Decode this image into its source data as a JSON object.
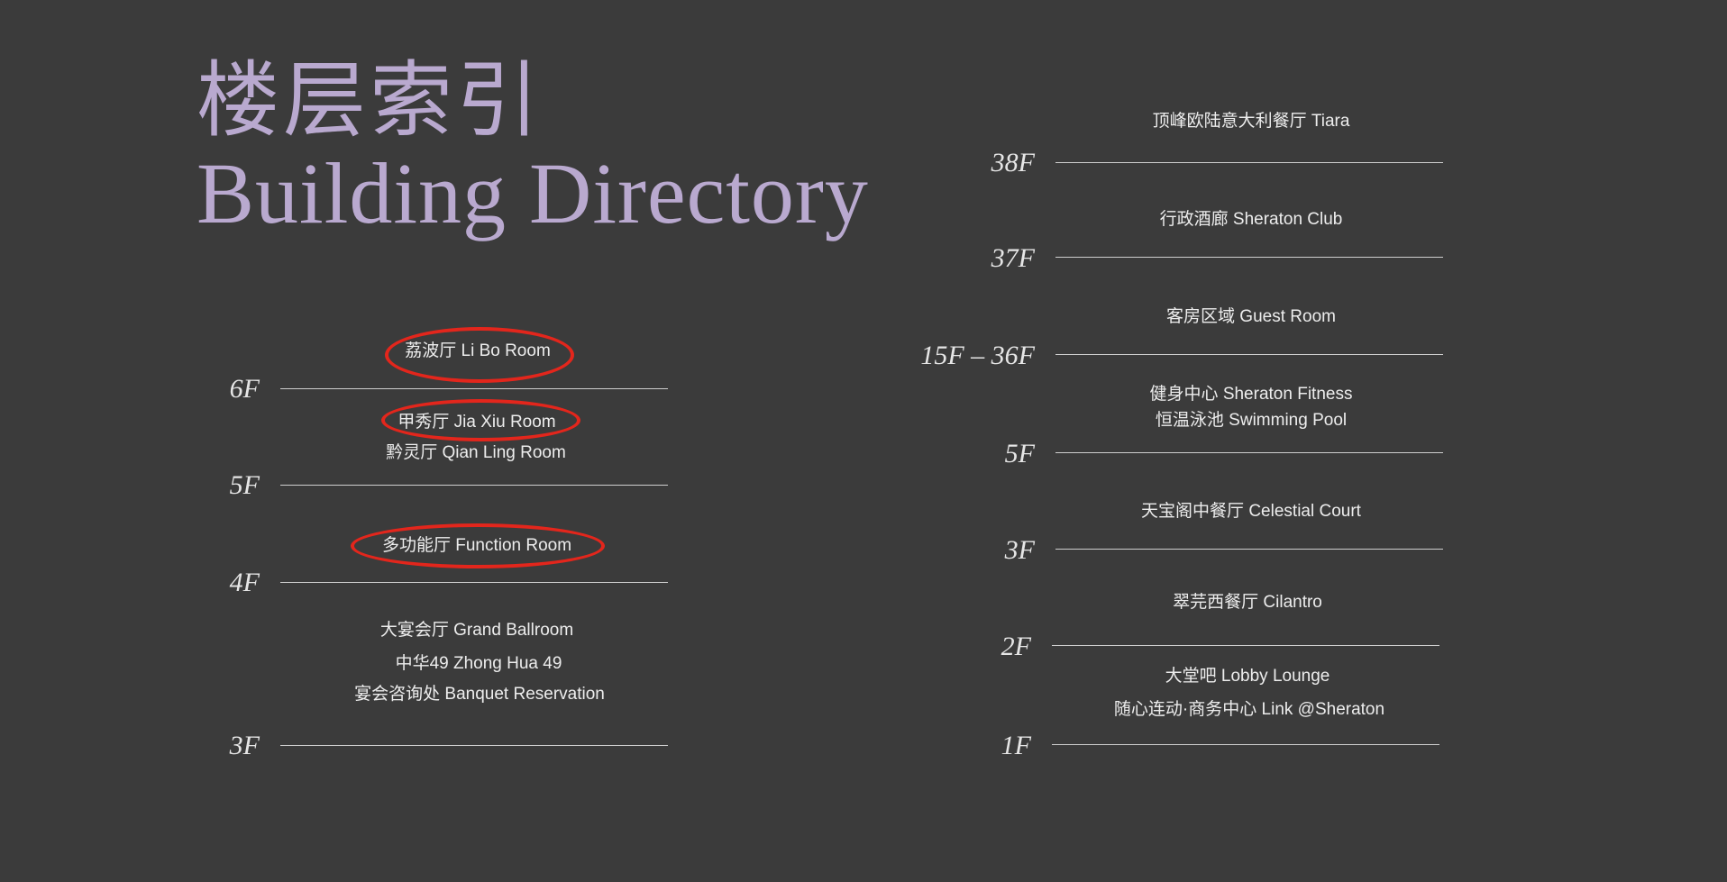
{
  "title": {
    "cn": "楼层索引",
    "en": "Building Directory"
  },
  "left_floors": {
    "f6": "6F",
    "f5": "5F",
    "f4": "4F",
    "f3": "3F"
  },
  "left_rooms": {
    "li_bo": "荔波厅 Li Bo Room",
    "jia_xiu": "甲秀厅 Jia Xiu Room",
    "qian_ling": "黔灵厅 Qian Ling Room",
    "function_room": "多功能厅 Function Room",
    "grand_ballroom": "大宴会厅 Grand Ballroom",
    "zhong_hua": "中华49 Zhong Hua 49",
    "banquet_reservation": "宴会咨询处 Banquet Reservation"
  },
  "right_floors": {
    "f38": "38F",
    "f37": "37F",
    "f15_36": "15F – 36F",
    "f5": "5F",
    "f3": "3F",
    "f2": "2F",
    "f1": "1F"
  },
  "right_rooms": {
    "tiara": "顶峰欧陆意大利餐厅 Tiara",
    "sheraton_club": "行政酒廊 Sheraton Club",
    "guest_room": "客房区域 Guest Room",
    "fitness": "健身中心 Sheraton Fitness",
    "pool": "恒温泳池 Swimming Pool",
    "celestial_court": "天宝阁中餐厅 Celestial Court",
    "cilantro": "翠芫西餐厅 Cilantro",
    "lobby_lounge": "大堂吧 Lobby Lounge",
    "link": "随心连动·商务中心 Link @Sheraton"
  },
  "annotation_color": "#e3261c",
  "title_color": "#b9a9cf"
}
